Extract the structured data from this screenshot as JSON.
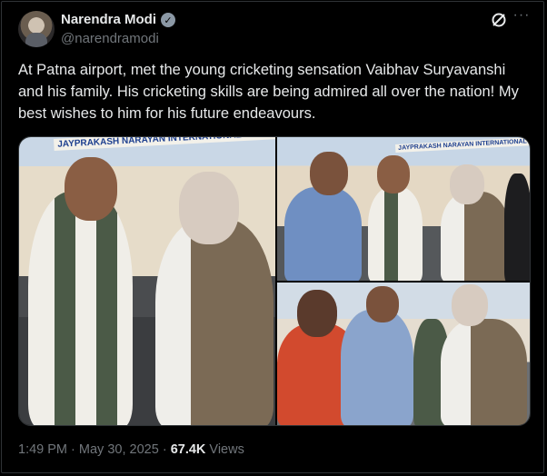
{
  "author": {
    "name": "Narendra Modi",
    "handle": "@narendramodi",
    "verified_icon": "check-badge-icon"
  },
  "header_icons": {
    "grok": "grok-icon",
    "more": "more-dots-icon",
    "more_glyph": "···"
  },
  "post": {
    "text": "At Patna airport, met the young cricketing sensation Vaibhav Suryavanshi and his family. His cricketing skills are being admired all over the nation! My best wishes to him for his future endeavours."
  },
  "media": {
    "photo1_sign": "JAYPRAKASH NARAYAN INTERNATIONAL AIRPORT",
    "photo2_sign": "JAYPRAKASH NARAYAN INTERNATIONAL AIRPORT"
  },
  "meta": {
    "time": "1:49 PM",
    "separator": "·",
    "date": "May 30, 2025",
    "separator2": "·",
    "views_count": "67.4K",
    "views_label": "Views"
  }
}
